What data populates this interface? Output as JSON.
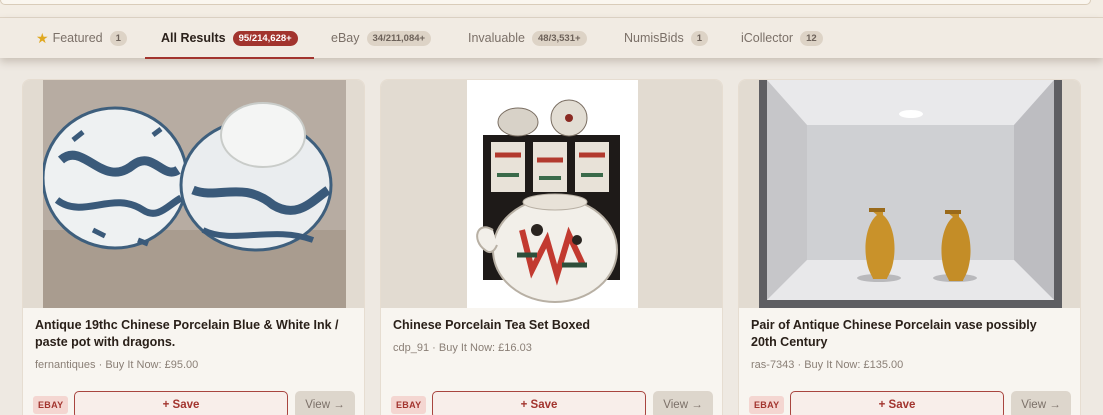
{
  "tabs": [
    {
      "label": "Featured",
      "count": "1",
      "icon": "star-icon"
    },
    {
      "label": "All Results",
      "count": "95/214,628+",
      "active": true
    },
    {
      "label": "eBay",
      "count": "34/211,084+"
    },
    {
      "label": "Invaluable",
      "count": "48/3,531+"
    },
    {
      "label": "NumisBids",
      "count": "1"
    },
    {
      "label": "iCollector",
      "count": "12"
    }
  ],
  "cards": [
    {
      "title": "Antique 19thc Chinese Porcelain Blue & White Ink / paste pot with dragons.",
      "meta": "fernantiques · Buy It Now: £95.00",
      "source": "EBAY",
      "save_label": "+ Save",
      "view_label": "View →"
    },
    {
      "title": "Chinese Porcelain Tea Set Boxed",
      "meta": "cdp_91 · Buy It Now: £16.03",
      "source": "EBAY",
      "save_label": "+ Save",
      "view_label": "View →"
    },
    {
      "title": "Pair of Antique Chinese Porcelain vase possibly 20th Century",
      "meta": "ras-7343 · Buy It Now: £135.00",
      "source": "EBAY",
      "save_label": "+ Save",
      "view_label": "View →"
    }
  ],
  "colors": {
    "accent": "#a2342e",
    "background": "#eee9e2"
  }
}
